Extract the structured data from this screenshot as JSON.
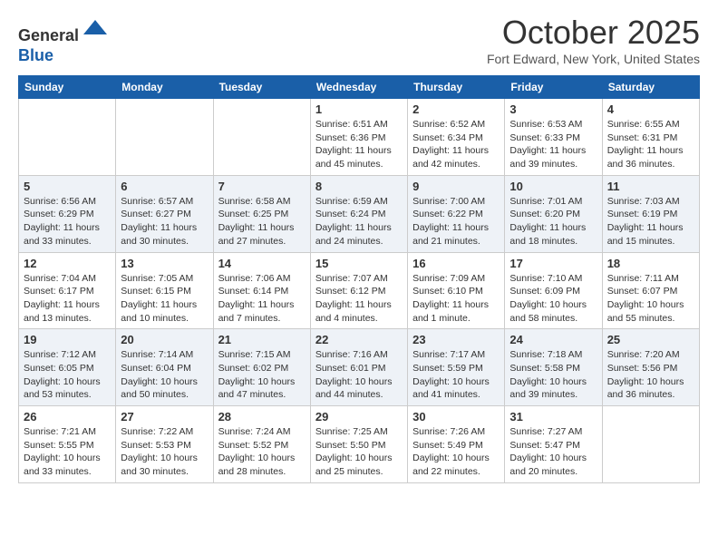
{
  "header": {
    "logo_general": "General",
    "logo_blue": "Blue",
    "month_title": "October 2025",
    "location": "Fort Edward, New York, United States"
  },
  "calendar": {
    "days_of_week": [
      "Sunday",
      "Monday",
      "Tuesday",
      "Wednesday",
      "Thursday",
      "Friday",
      "Saturday"
    ],
    "weeks": [
      {
        "days": [
          {
            "num": "",
            "info": ""
          },
          {
            "num": "",
            "info": ""
          },
          {
            "num": "",
            "info": ""
          },
          {
            "num": "1",
            "info": "Sunrise: 6:51 AM\nSunset: 6:36 PM\nDaylight: 11 hours and 45 minutes."
          },
          {
            "num": "2",
            "info": "Sunrise: 6:52 AM\nSunset: 6:34 PM\nDaylight: 11 hours and 42 minutes."
          },
          {
            "num": "3",
            "info": "Sunrise: 6:53 AM\nSunset: 6:33 PM\nDaylight: 11 hours and 39 minutes."
          },
          {
            "num": "4",
            "info": "Sunrise: 6:55 AM\nSunset: 6:31 PM\nDaylight: 11 hours and 36 minutes."
          }
        ]
      },
      {
        "days": [
          {
            "num": "5",
            "info": "Sunrise: 6:56 AM\nSunset: 6:29 PM\nDaylight: 11 hours and 33 minutes."
          },
          {
            "num": "6",
            "info": "Sunrise: 6:57 AM\nSunset: 6:27 PM\nDaylight: 11 hours and 30 minutes."
          },
          {
            "num": "7",
            "info": "Sunrise: 6:58 AM\nSunset: 6:25 PM\nDaylight: 11 hours and 27 minutes."
          },
          {
            "num": "8",
            "info": "Sunrise: 6:59 AM\nSunset: 6:24 PM\nDaylight: 11 hours and 24 minutes."
          },
          {
            "num": "9",
            "info": "Sunrise: 7:00 AM\nSunset: 6:22 PM\nDaylight: 11 hours and 21 minutes."
          },
          {
            "num": "10",
            "info": "Sunrise: 7:01 AM\nSunset: 6:20 PM\nDaylight: 11 hours and 18 minutes."
          },
          {
            "num": "11",
            "info": "Sunrise: 7:03 AM\nSunset: 6:19 PM\nDaylight: 11 hours and 15 minutes."
          }
        ]
      },
      {
        "days": [
          {
            "num": "12",
            "info": "Sunrise: 7:04 AM\nSunset: 6:17 PM\nDaylight: 11 hours and 13 minutes."
          },
          {
            "num": "13",
            "info": "Sunrise: 7:05 AM\nSunset: 6:15 PM\nDaylight: 11 hours and 10 minutes."
          },
          {
            "num": "14",
            "info": "Sunrise: 7:06 AM\nSunset: 6:14 PM\nDaylight: 11 hours and 7 minutes."
          },
          {
            "num": "15",
            "info": "Sunrise: 7:07 AM\nSunset: 6:12 PM\nDaylight: 11 hours and 4 minutes."
          },
          {
            "num": "16",
            "info": "Sunrise: 7:09 AM\nSunset: 6:10 PM\nDaylight: 11 hours and 1 minute."
          },
          {
            "num": "17",
            "info": "Sunrise: 7:10 AM\nSunset: 6:09 PM\nDaylight: 10 hours and 58 minutes."
          },
          {
            "num": "18",
            "info": "Sunrise: 7:11 AM\nSunset: 6:07 PM\nDaylight: 10 hours and 55 minutes."
          }
        ]
      },
      {
        "days": [
          {
            "num": "19",
            "info": "Sunrise: 7:12 AM\nSunset: 6:05 PM\nDaylight: 10 hours and 53 minutes."
          },
          {
            "num": "20",
            "info": "Sunrise: 7:14 AM\nSunset: 6:04 PM\nDaylight: 10 hours and 50 minutes."
          },
          {
            "num": "21",
            "info": "Sunrise: 7:15 AM\nSunset: 6:02 PM\nDaylight: 10 hours and 47 minutes."
          },
          {
            "num": "22",
            "info": "Sunrise: 7:16 AM\nSunset: 6:01 PM\nDaylight: 10 hours and 44 minutes."
          },
          {
            "num": "23",
            "info": "Sunrise: 7:17 AM\nSunset: 5:59 PM\nDaylight: 10 hours and 41 minutes."
          },
          {
            "num": "24",
            "info": "Sunrise: 7:18 AM\nSunset: 5:58 PM\nDaylight: 10 hours and 39 minutes."
          },
          {
            "num": "25",
            "info": "Sunrise: 7:20 AM\nSunset: 5:56 PM\nDaylight: 10 hours and 36 minutes."
          }
        ]
      },
      {
        "days": [
          {
            "num": "26",
            "info": "Sunrise: 7:21 AM\nSunset: 5:55 PM\nDaylight: 10 hours and 33 minutes."
          },
          {
            "num": "27",
            "info": "Sunrise: 7:22 AM\nSunset: 5:53 PM\nDaylight: 10 hours and 30 minutes."
          },
          {
            "num": "28",
            "info": "Sunrise: 7:24 AM\nSunset: 5:52 PM\nDaylight: 10 hours and 28 minutes."
          },
          {
            "num": "29",
            "info": "Sunrise: 7:25 AM\nSunset: 5:50 PM\nDaylight: 10 hours and 25 minutes."
          },
          {
            "num": "30",
            "info": "Sunrise: 7:26 AM\nSunset: 5:49 PM\nDaylight: 10 hours and 22 minutes."
          },
          {
            "num": "31",
            "info": "Sunrise: 7:27 AM\nSunset: 5:47 PM\nDaylight: 10 hours and 20 minutes."
          },
          {
            "num": "",
            "info": ""
          }
        ]
      }
    ]
  }
}
